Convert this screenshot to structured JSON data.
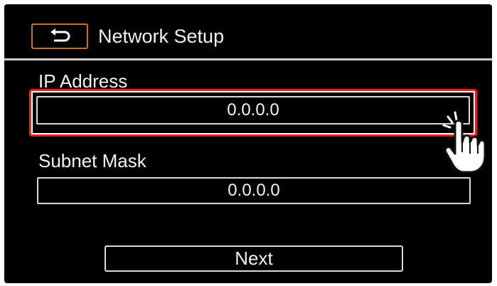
{
  "header": {
    "back_icon": "return-arrow-icon",
    "title": "Network Setup"
  },
  "ip_address": {
    "label": "IP Address",
    "value": "0.0.0.0",
    "highlighted": true,
    "highlight_color": "#ff1a1a"
  },
  "subnet_mask": {
    "label": "Subnet Mask",
    "value": "0.0.0.0"
  },
  "footer": {
    "next_label": "Next"
  },
  "overlay": {
    "pointer_icon": "tapping-hand-icon"
  },
  "colors": {
    "background": "#000000",
    "text": "#f2f2f2",
    "back_button_border": "#c8731f"
  }
}
